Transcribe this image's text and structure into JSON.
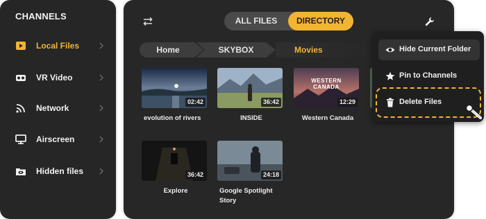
{
  "sidebar": {
    "title": "CHANNELS",
    "items": [
      {
        "label": "Local Files",
        "icon": "play-folder-icon",
        "active": true
      },
      {
        "label": "VR Video",
        "icon": "vr-headset-icon",
        "active": false
      },
      {
        "label": "Network",
        "icon": "wifi-icon",
        "active": false
      },
      {
        "label": "Airscreen",
        "icon": "monitor-icon",
        "active": false
      },
      {
        "label": "Hidden files",
        "icon": "hidden-folder-icon",
        "active": false
      }
    ]
  },
  "toolbar": {
    "tab_all": "ALL FILES",
    "tab_directory": "DIRECTORY",
    "active_tab": "DIRECTORY"
  },
  "breadcrumb": {
    "items": [
      "Home",
      "SKYBOX",
      "Movies"
    ]
  },
  "files": [
    {
      "name": "evolution of rivers",
      "duration": "02:42"
    },
    {
      "name": "INSIDE",
      "duration": "36:42"
    },
    {
      "name": "Western Canada",
      "duration": "12:29",
      "overlay_text": "WESTERN CANADA"
    },
    {
      "name": "Explore",
      "duration": "36:42"
    },
    {
      "name": "Google Spotlight Story",
      "duration": "24:18"
    }
  ],
  "context_menu": {
    "items": [
      {
        "label": "Hide Current Folder",
        "icon": "eye-icon"
      },
      {
        "label": "Pin to Channels",
        "icon": "star-icon"
      },
      {
        "label": "Delete Files",
        "icon": "trash-icon"
      }
    ]
  },
  "colors": {
    "accent": "#f2b531",
    "panel": "#262626",
    "menu": "#1f1f1f"
  }
}
